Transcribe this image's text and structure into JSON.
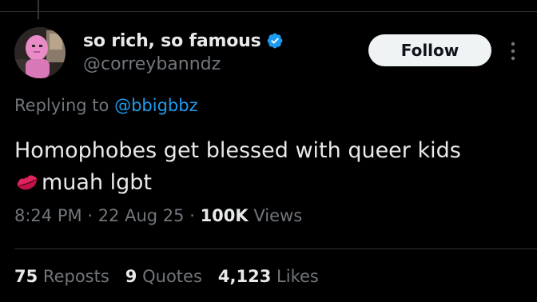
{
  "tweet": {
    "author": {
      "display_name": "so rich, so famous",
      "handle": "@correybanndz",
      "verified": true
    },
    "follow_label": "Follow",
    "replying_prefix": "Replying to",
    "replying_to": "@bbigbbz",
    "text_line1": "Homophobes get blessed with queer kids",
    "text_line2": "muah lgbt",
    "emoji": "kiss-lips-icon",
    "time": "8:24 PM",
    "date": "22 Aug 25",
    "views_count": "100K",
    "views_label": "Views",
    "separator": "·",
    "stats": {
      "reposts_count": "75",
      "reposts_label": "Reposts",
      "quotes_count": "9",
      "quotes_label": "Quotes",
      "likes_count": "4,123",
      "likes_label": "Likes"
    }
  },
  "colors": {
    "background": "#000000",
    "text": "#e7e9ea",
    "secondary_text": "#71767b",
    "link": "#1d9bf0",
    "verified_badge": "#1d9bf0",
    "follow_button_bg": "#eff3f4",
    "divider": "#2f3336"
  }
}
